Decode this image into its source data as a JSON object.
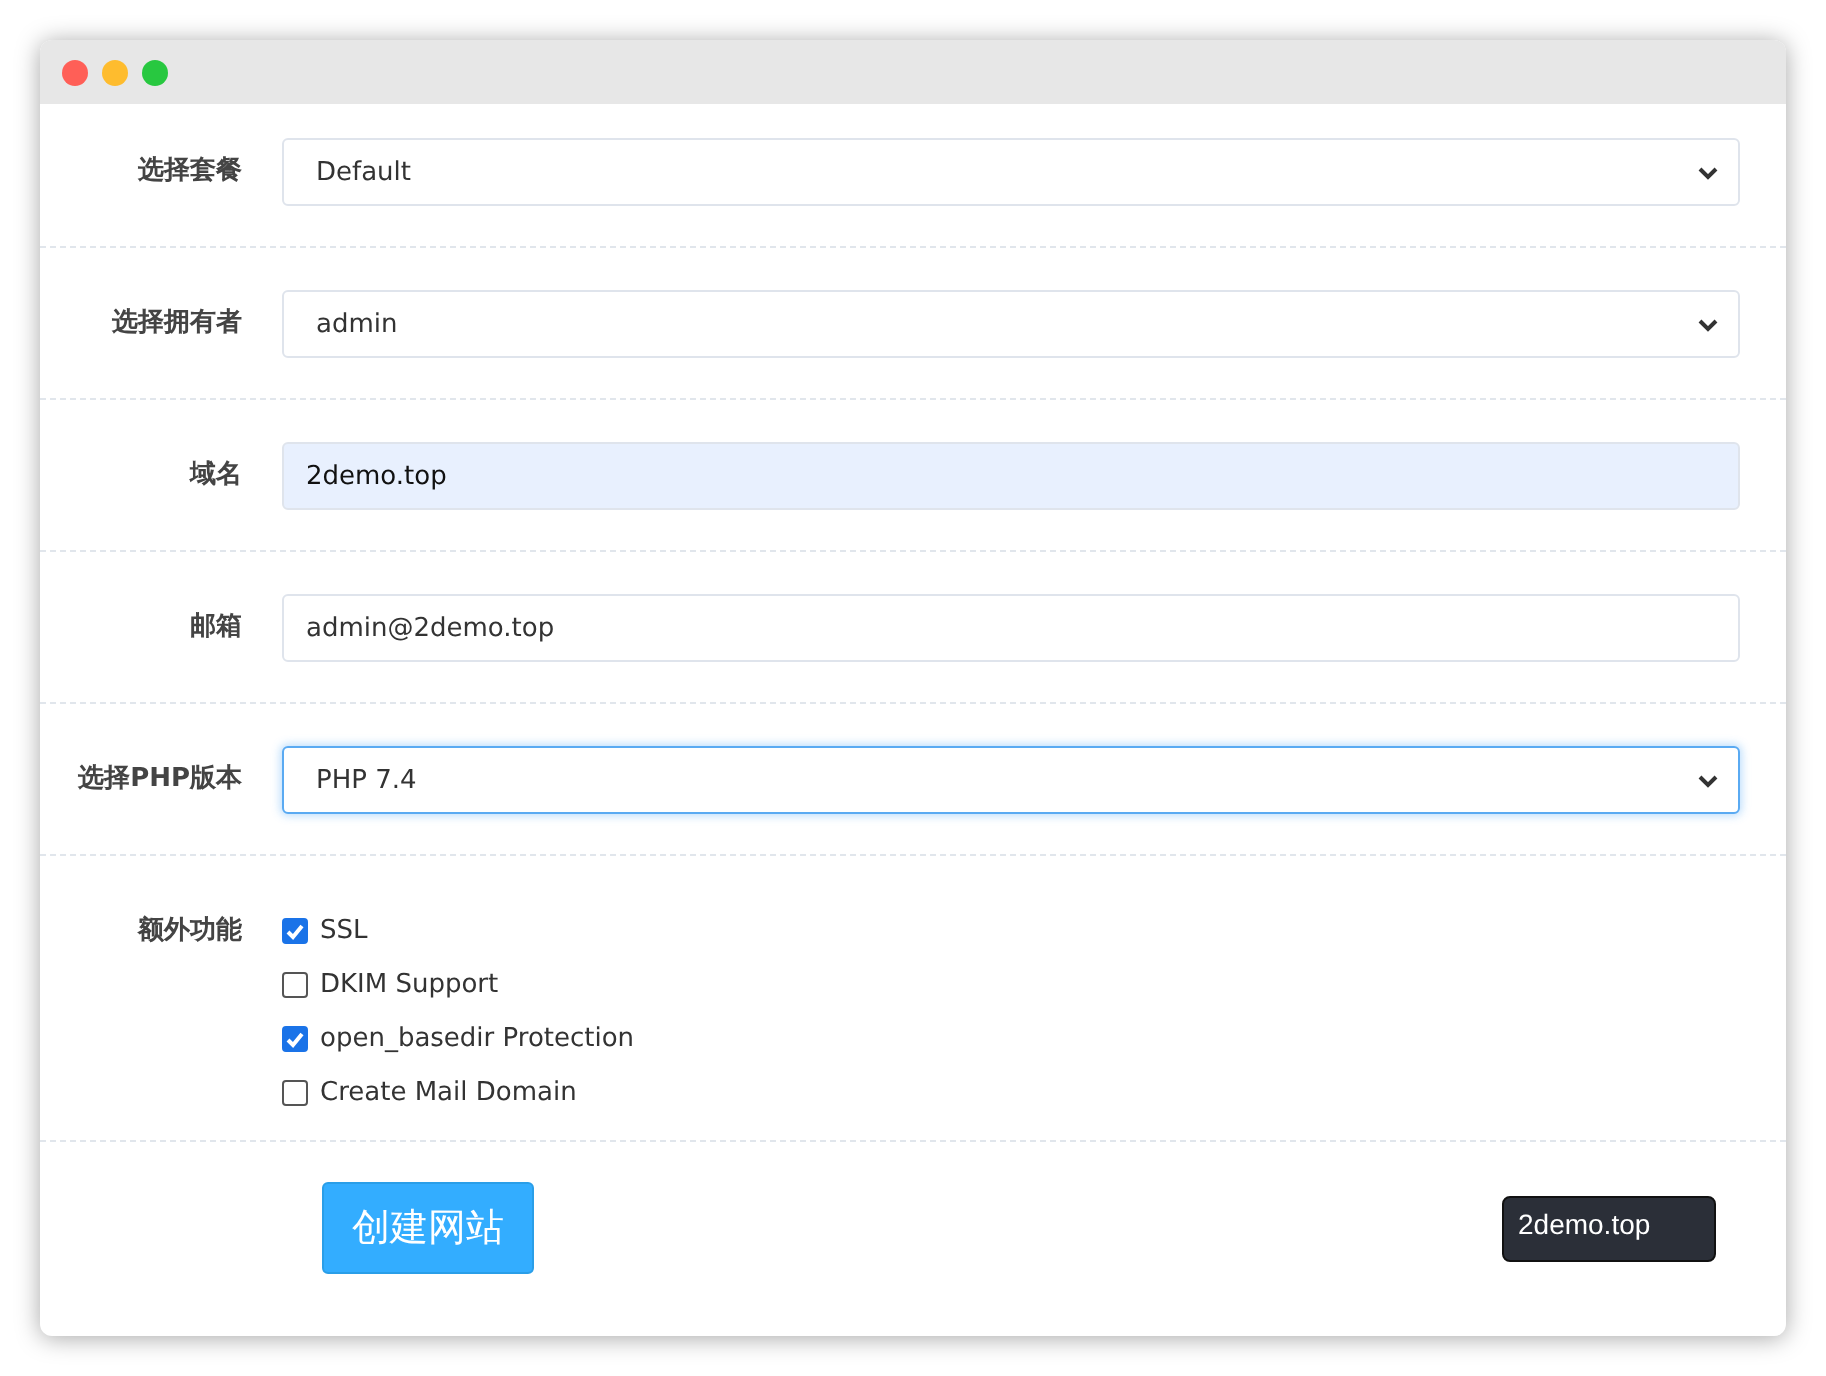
{
  "window": {
    "controls": [
      {
        "color": "#ff5f57"
      },
      {
        "color": "#febc2e"
      },
      {
        "color": "#28c840"
      }
    ]
  },
  "form": {
    "rows": [
      {
        "label": "选择套餐",
        "field": {
          "kind": "select",
          "value": "Default",
          "focused": false,
          "autofilled": false
        }
      },
      {
        "label": "选择拥有者",
        "field": {
          "kind": "select",
          "value": "admin",
          "focused": false,
          "autofilled": false
        }
      },
      {
        "label": "域名",
        "field": {
          "kind": "input",
          "value": "2demo.top",
          "focused": false,
          "autofilled": true
        }
      },
      {
        "label": "邮箱",
        "field": {
          "kind": "input",
          "value": "admin@2demo.top",
          "focused": false,
          "autofilled": false
        }
      },
      {
        "label": "选择PHP版本",
        "field": {
          "kind": "select",
          "value": "PHP 7.4",
          "focused": true,
          "autofilled": false
        }
      }
    ]
  },
  "extras": {
    "label": "额外功能",
    "options": [
      {
        "label": "SSL",
        "checked": true
      },
      {
        "label": "DKIM Support",
        "checked": false
      },
      {
        "label": "open_basedir Protection",
        "checked": true
      },
      {
        "label": "Create Mail Domain",
        "checked": false
      }
    ]
  },
  "submit": {
    "label": "创建网站"
  },
  "tooltip": {
    "text": "2demo.top"
  }
}
